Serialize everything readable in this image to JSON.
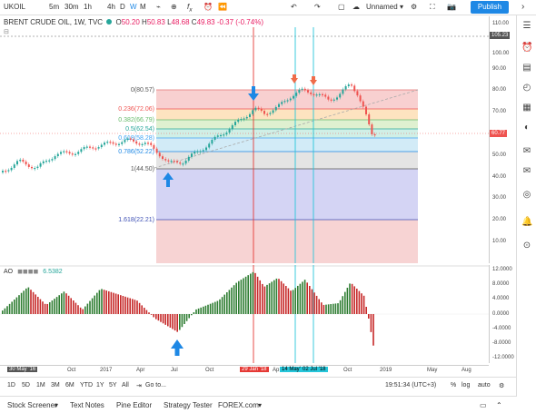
{
  "toolbar": {
    "symbol": "UKOIL",
    "intervals": [
      "5m",
      "30m",
      "1h",
      "4h",
      "D",
      "W",
      "M"
    ],
    "active_interval": "W",
    "layout_name": "Unnamed",
    "publish_label": "Publish"
  },
  "legend": {
    "title": "BRENT CRUDE OIL, 1W, TVC",
    "open_label": "O",
    "open": "50.20",
    "high_label": "H",
    "high": "50.83",
    "low_label": "L",
    "low": "48.68",
    "close_label": "C",
    "close": "49.83",
    "change": "-0.37 (-0.74%)"
  },
  "fib_levels": [
    {
      "label": "0(80.57)",
      "color": "#e57373"
    },
    {
      "label": "0.236(72.06)",
      "color": "#ef5350"
    },
    {
      "label": "0.382(66.79)",
      "color": "#66bb6a"
    },
    {
      "label": "0.5(62.54)",
      "color": "#26a69a"
    },
    {
      "label": "0.618(58.28)",
      "color": "#42a5f5"
    },
    {
      "label": "0.786(52.22)",
      "color": "#1e88e5"
    },
    {
      "label": "1(44.50)",
      "color": "#555555"
    },
    {
      "label": "1.618(22.21)",
      "color": "#3f51b5"
    }
  ],
  "price_axis": [
    "110.00",
    "105.23",
    "100.00",
    "90.00",
    "80.00",
    "70.00",
    "60.77",
    "50.00",
    "40.00",
    "30.00",
    "20.00",
    "10.00"
  ],
  "price_badges": {
    "top": "105.23",
    "current": "60.77"
  },
  "ao": {
    "label": "AO",
    "value": "6.5382"
  },
  "ao_axis": [
    "12.0000",
    "8.0000",
    "4.0000",
    "0.0000",
    "-4.0000",
    "-8.0000",
    "-12.0000"
  ],
  "time_axis": [
    "30 May '16",
    "Oct",
    "2017",
    "Apr",
    "Jul",
    "Oct",
    "29 Jan '18",
    "Ap",
    "14 May'",
    "02 Jul '18",
    "Oct",
    "2019",
    "May",
    "Aug"
  ],
  "range_bar": {
    "ranges": [
      "1D",
      "5D",
      "1M",
      "3M",
      "6M",
      "YTD",
      "1Y",
      "5Y",
      "All"
    ],
    "goto": "Go to...",
    "clock": "19:51:34 (UTC+3)",
    "percent": "%",
    "log": "log",
    "auto": "auto"
  },
  "bottom_tabs": [
    "Stock Screener",
    "Text Notes",
    "Pine Editor",
    "Strategy Tester",
    "FOREX.com"
  ],
  "colors": {
    "up": "#26a69a",
    "down": "#ef5350",
    "vline_red": "#e53935",
    "vline_blue": "#26c6da",
    "arrow": "#1e88e5"
  }
}
